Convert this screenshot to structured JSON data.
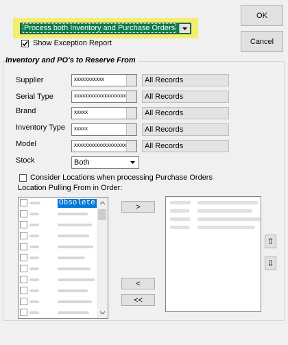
{
  "top": {
    "reserve_mode": "Process both Inventory and Purchase Orders",
    "show_exception_label": "Show Exception Report",
    "show_exception_checked": true
  },
  "buttons": {
    "ok": "OK",
    "cancel": "Cancel"
  },
  "section": {
    "title": "Inventory and PO's to Reserve From"
  },
  "filters": [
    {
      "label": "Supplier",
      "value": "xxxxxxxxxxx",
      "summary": "All Records"
    },
    {
      "label": "Serial Type",
      "value": "xxxxxxxxxxxxxxxxxxxxxx",
      "summary": "All Records"
    },
    {
      "label": "Brand",
      "value": "xxxxx",
      "summary": "All Records"
    },
    {
      "label": "Inventory Type",
      "value": "xxxxx",
      "summary": "All Records"
    },
    {
      "label": "Model",
      "value": "xxxxxxxxxxxxxxxxxxxxxxx",
      "summary": "All Records"
    }
  ],
  "stock": {
    "label": "Stock",
    "value": "Both"
  },
  "locations": {
    "consider_label": "Consider Locations when processing Purchase Orders",
    "consider_checked": false,
    "pulling_label": "Location Pulling From in Order:",
    "first_item": "Obsolete"
  },
  "transfer": {
    "add": ">",
    "remove": "<",
    "remove_all": "<<"
  },
  "order": {
    "up": "⇧",
    "down": "⇩"
  }
}
